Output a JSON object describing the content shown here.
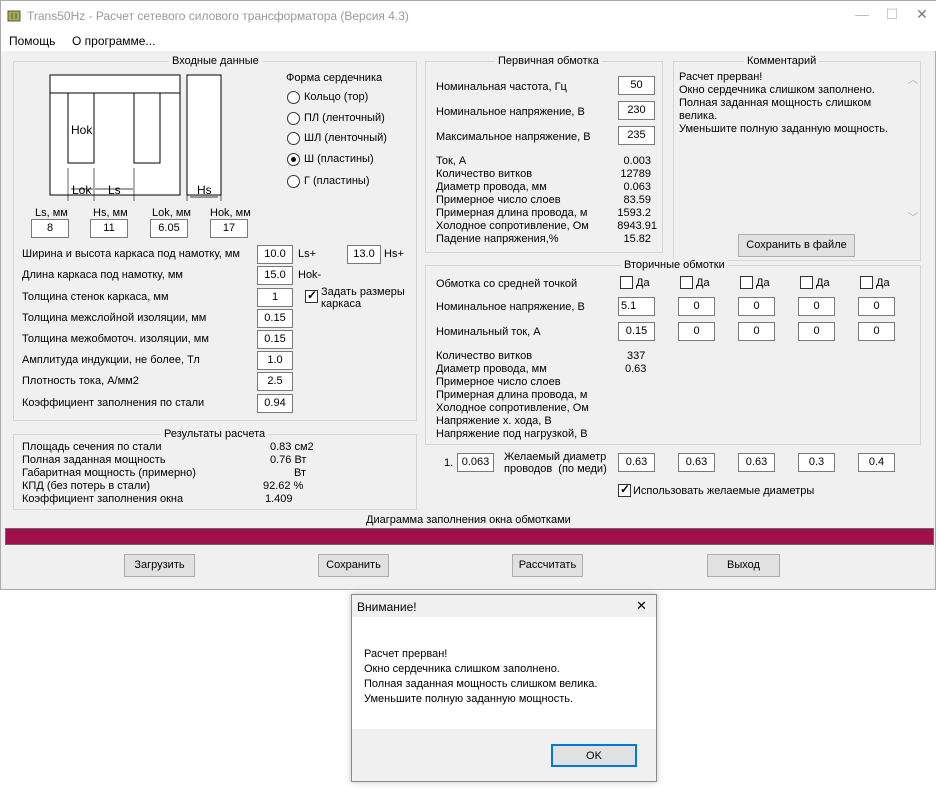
{
  "window": {
    "title": "Trans50Hz - Расчет сетевого силового трансформатора (Версия 4.3)",
    "controls": {
      "minimize": "—",
      "maximize": "☐",
      "close": "✕"
    }
  },
  "menu": [
    "Помощь",
    "О программе..."
  ],
  "input_group": {
    "caption": "Входные данные",
    "diagram_labels": {
      "hok": "Hok",
      "lok": "Lok",
      "ls": "Ls",
      "hs": "Hs"
    },
    "dims": [
      {
        "label": "Ls, мм",
        "value": "8"
      },
      {
        "label": "Hs, мм",
        "value": "11"
      },
      {
        "label": "Lok, мм",
        "value": "6.05"
      },
      {
        "label": "Hok, мм",
        "value": "17"
      }
    ],
    "core_shape": {
      "title": "Форма сердечника",
      "options": [
        {
          "label": "Кольцо  (тор)",
          "selected": false
        },
        {
          "label": "ПЛ  (ленточный)",
          "selected": false
        },
        {
          "label": "ШЛ  (ленточный)",
          "selected": false
        },
        {
          "label": "Ш  (пластины)",
          "selected": true
        },
        {
          "label": "Г (пластины)",
          "selected": false
        }
      ]
    },
    "params": [
      {
        "label": "Ширина и высота каркаса под намотку, мм",
        "value": "10.0"
      },
      {
        "label": "Длина каркаса под намотку, мм",
        "value": "15.0"
      },
      {
        "label": "Толщина стенок каркаса, мм",
        "value": "1"
      },
      {
        "label": "Толщина межслойной изоляции, мм",
        "value": "0.15"
      },
      {
        "label": "Толщина межобмоточ. изоляции, мм",
        "value": "0.15"
      },
      {
        "label": "Амплитуда индукции, не более, Тл",
        "value": "1.0"
      },
      {
        "label": "Плотность тока, А/мм2",
        "value": "2.5"
      },
      {
        "label": "Коэффициент заполнения по стали",
        "value": "0.94"
      }
    ],
    "ls_plus": "Ls+",
    "hs_value": "13.0",
    "hs_plus": "Hs+",
    "hok_minus": "Hok-",
    "set_frame_label": "Задать размеры\nкаркаса",
    "set_frame_checked": true
  },
  "results": {
    "caption": "Результаты расчета",
    "rows": [
      {
        "label": "Площадь сечения по стали",
        "value": "0.83 см2"
      },
      {
        "label": "Полная заданная мощность",
        "value": "0.76 Вт"
      },
      {
        "label": "Габаритная мощность (примерно)",
        "value": "Вт"
      },
      {
        "label": "КПД (без потерь в стали)",
        "value": "92.62 %"
      },
      {
        "label": "Коэффициент заполнения окна",
        "value": "1.409"
      }
    ]
  },
  "primary": {
    "caption": "Первичная обмотка",
    "inputs": [
      {
        "label": "Номинальная частота, Гц",
        "value": "50"
      },
      {
        "label": "Номинальное напряжение, В",
        "value": "230"
      },
      {
        "label": "Максимальное напряжение, В",
        "value": "235"
      }
    ],
    "rows": [
      {
        "label": "Ток, А",
        "value": "0.003"
      },
      {
        "label": "Количество витков",
        "value": "12789"
      },
      {
        "label": "Диаметр провода, мм",
        "value": "0.063"
      },
      {
        "label": "Примерное число слоев",
        "value": "83.59"
      },
      {
        "label": "Примерная длина провода, м",
        "value": "1593.2"
      },
      {
        "label": "Холодное сопротивление, Ом",
        "value": "8943.91"
      },
      {
        "label": "Падение напряжения,%",
        "value": "15.82"
      }
    ]
  },
  "comment": {
    "caption": "Комментарий",
    "lines": [
      "Расчет прерван!",
      "Окно сердечника слишком заполнено.",
      "Полная заданная мощность слишком",
      "велика.",
      "Уменьшите полную заданную мощность."
    ],
    "save_button": "Сохранить в файле"
  },
  "secondary": {
    "caption": "Вторичные обмотки",
    "center_tap_label": "Обмотка со средней точкой",
    "checkbox_label": "Да",
    "voltage_label": "Номинальное напряжение, В",
    "current_label": "Номинальный ток, А",
    "voltages": [
      "5.1",
      "0",
      "0",
      "0",
      "0"
    ],
    "currents": [
      "0.15",
      "0",
      "0",
      "0",
      "0"
    ],
    "rows": [
      {
        "label": "Количество витков",
        "value": "337"
      },
      {
        "label": "Диаметр провода, мм",
        "value": "0.63"
      },
      {
        "label": "Примерное число слоев",
        "value": ""
      },
      {
        "label": "Примерная длина провода, м",
        "value": ""
      },
      {
        "label": "Холодное сопротивление, Ом",
        "value": ""
      },
      {
        "label": "Напряжение х. хода, В",
        "value": ""
      },
      {
        "label": "Напряжение под нагрузкой, В",
        "value": ""
      }
    ]
  },
  "wire": {
    "index_label": "1.",
    "primary_value": "0.063",
    "desired_label": "Желаемый диаметр\nпроводов  (по меди)",
    "values": [
      "0.63",
      "0.63",
      "0.63",
      "0.3",
      "0.4"
    ],
    "use_label": "Использовать желаемые диаметры",
    "use_checked": true
  },
  "fill_diagram": {
    "label": "Диаграмма заполнения окна обмотками",
    "fill": 1.0,
    "color": "#a0104a"
  },
  "buttons": {
    "load": "Загрузить",
    "save": "Сохранить",
    "calc": "Рассчитать",
    "exit": "Выход"
  },
  "dialog": {
    "title": "Внимание!",
    "close": "✕",
    "lines": [
      "Расчет прерван!",
      "Окно сердечника слишком заполнено.",
      "Полная заданная мощность слишком велика.",
      "Уменьшите полную заданную мощность."
    ],
    "ok": "OK"
  }
}
